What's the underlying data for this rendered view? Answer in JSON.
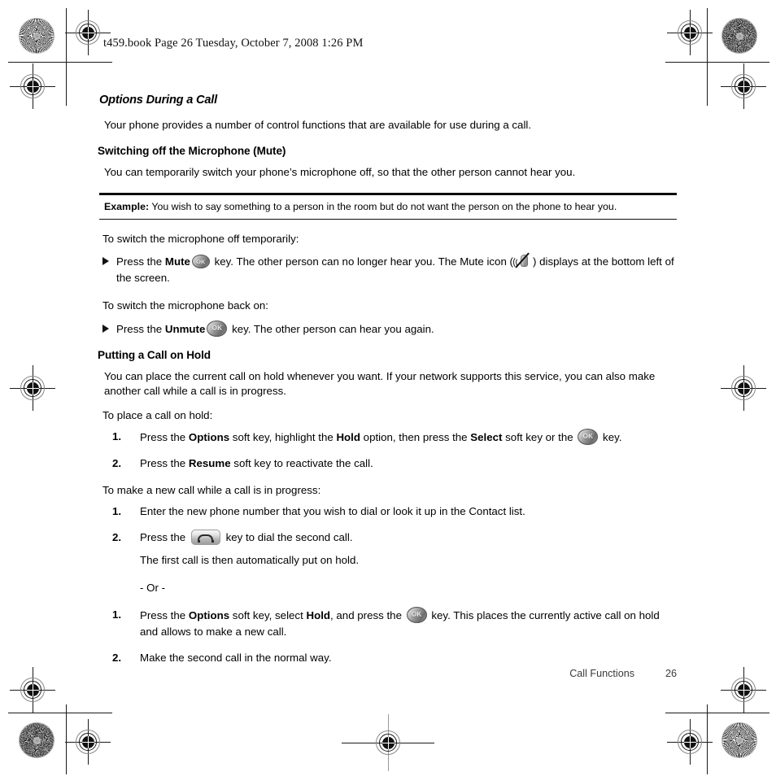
{
  "page": {
    "file_header": "t459.book  Page 26  Tuesday, October 7, 2008  1:26 PM",
    "file_header_parts": {
      "filename": "t459.book",
      "page_label": "Page 26",
      "date": "Tuesday, October 7, 2008",
      "time": "1:26 PM"
    },
    "footer": {
      "chapter": "Call Functions",
      "page_number": "26"
    }
  },
  "section": {
    "heading": "Options During a Call",
    "intro": "Your phone provides a number of control functions that are available for use during a call."
  },
  "mute": {
    "heading": "Switching off the Microphone (Mute)",
    "intro": "You can temporarily switch your phone’s microphone off, so that the other person cannot hear you.",
    "example": {
      "label": "Example:",
      "text": "You wish to say something to a person in the room but do not want the person on the phone to hear you."
    },
    "lead_off": "To switch the microphone off temporarily:",
    "step_off": {
      "t1": "Press the ",
      "kw1": "Mute",
      "t2": " key. The other person can no longer hear you. The Mute icon (",
      "t3": ") displays at the bottom left of the screen."
    },
    "lead_on": "To switch the microphone back on:",
    "step_on": {
      "t1": "Press the ",
      "kw1": "Unmute",
      "t2": " key. The other person can hear you again."
    }
  },
  "hold": {
    "heading": "Putting a Call on Hold",
    "intro": "You can place the current call on hold whenever you want. If your network supports this service, you can also make another call while a call is in progress.",
    "lead_place": "To place a call on hold:",
    "steps_place": [
      {
        "num": "1.",
        "t1": "Press the ",
        "kw1": "Options",
        "t2": " soft key, highlight the ",
        "kw2": "Hold",
        "t3": " option, then press the ",
        "kw3": "Select",
        "t4": " soft key or the ",
        "t5": " key."
      },
      {
        "num": "2.",
        "t1": "Press the ",
        "kw1": "Resume",
        "t2": " soft key to reactivate the call."
      }
    ],
    "lead_new": "To make a new call while a call is in progress:",
    "steps_new": [
      {
        "num": "1.",
        "t1": "Enter the new phone number that you wish to dial or look it up in the Contact list."
      },
      {
        "num": "2.",
        "t1": "Press the ",
        "t2": " key to dial the second call.",
        "sub1": "The first call is then automatically put on hold.",
        "sub2": "- Or -"
      }
    ],
    "steps_or": [
      {
        "num": "1.",
        "t1": "Press the ",
        "kw1": "Options",
        "t2": " soft key, select ",
        "kw2": "Hold",
        "t3": ", and press the ",
        "t4": " key. This places the currently active call on hold and allows to make a new call."
      },
      {
        "num": "2.",
        "t1": "Make the second call in the normal way."
      }
    ]
  },
  "icons": {
    "ok_key": "ok-key-icon",
    "send_key": "send-key-icon",
    "mute_status": "mute-status-icon",
    "registration": "registration-crosshair-mark",
    "starburst": "starburst-resolution-target"
  },
  "colors": {
    "ink": "#000000",
    "rule": "#0d0d0d",
    "paper": "#ffffff",
    "footer_text": "#3a3a3a"
  }
}
